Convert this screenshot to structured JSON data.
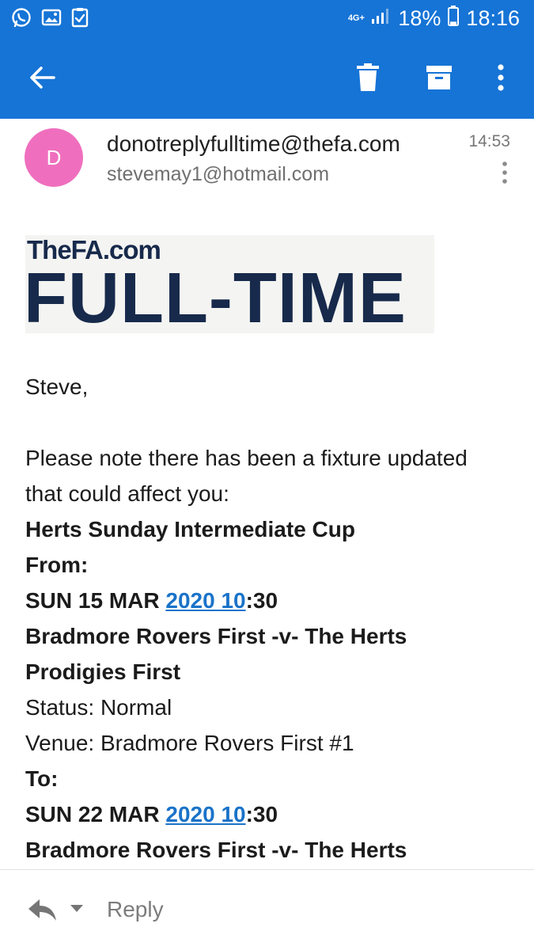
{
  "status_bar": {
    "network": "4G+",
    "battery_percent": "18%",
    "battery_level": 0.18,
    "time": "18:16",
    "notification_icons": [
      "whatsapp-icon",
      "image-icon",
      "clipboard-check-icon"
    ]
  },
  "app_bar": {
    "actions": [
      "back-arrow-icon",
      "delete-icon",
      "archive-icon",
      "overflow-menu-icon"
    ]
  },
  "email": {
    "avatar_letter": "D",
    "sender": "donotreplyfulltime@thefa.com",
    "recipient": "stevemay1@hotmail.com",
    "time": "14:53",
    "logo": {
      "top": "TheFA.com",
      "main": "FULL-TIME"
    },
    "greeting": "Steve,",
    "intro_line1": "Please note there has been a fixture updated",
    "intro_line2": "that could affect you:",
    "competition": "Herts Sunday Intermediate Cup",
    "from_label": "From:",
    "from_date_prefix": "SUN 15 MAR ",
    "from_date_link": "2020 10",
    "from_date_suffix": ":30",
    "from_match_line1": "Bradmore Rovers First -v- The Herts",
    "from_match_line2": "Prodigies First",
    "from_status": "Status: Normal",
    "from_venue": "Venue: Bradmore Rovers First #1",
    "to_label": "To:",
    "to_date_prefix": "SUN 22 MAR ",
    "to_date_link": "2020 10",
    "to_date_suffix": ":30",
    "to_match_line1": "Bradmore Rovers First -v- The Herts"
  },
  "bottom_bar": {
    "reply_label": "Reply"
  },
  "colors": {
    "app_bar": "#1674d6",
    "avatar": "#ef6fbe",
    "link": "#1a73c9",
    "logo_text": "#172a4b"
  }
}
